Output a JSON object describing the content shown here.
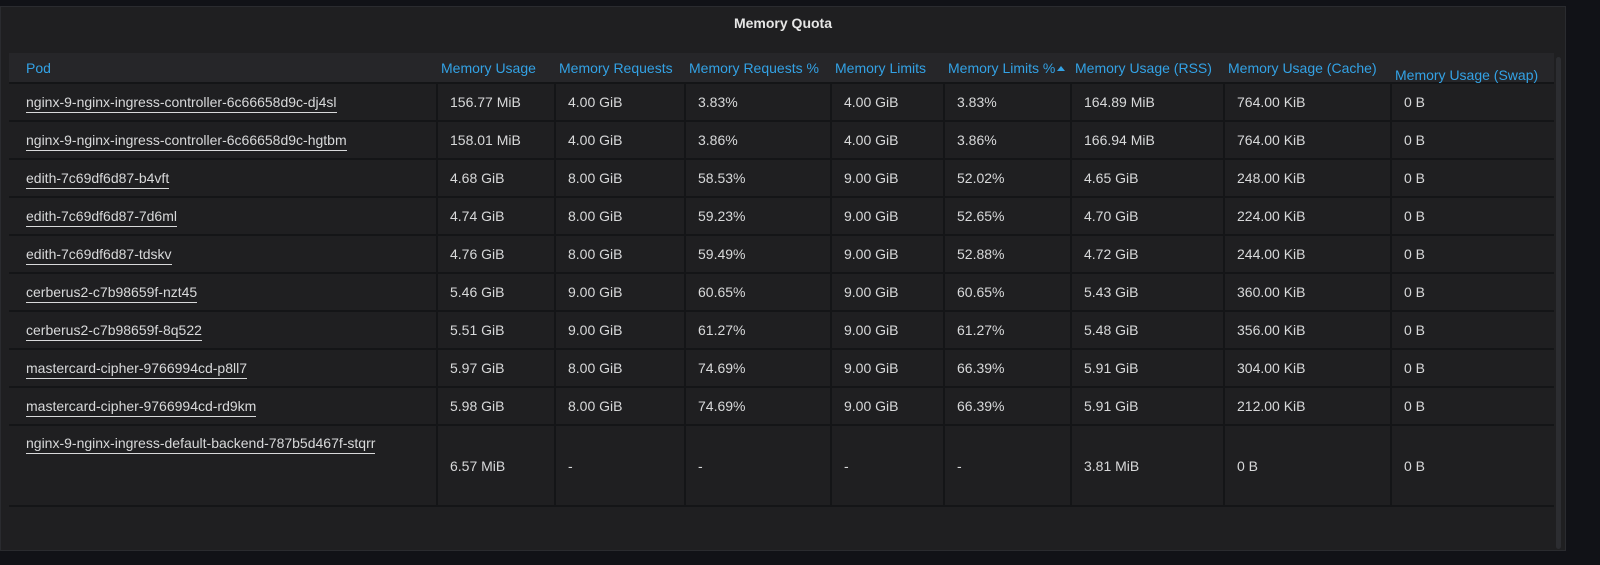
{
  "panel": {
    "title": "Memory Quota"
  },
  "table": {
    "columns": [
      "Pod",
      "Memory Usage",
      "Memory Requests",
      "Memory Requests %",
      "Memory Limits",
      "Memory Limits %",
      "Memory Usage (RSS)",
      "Memory Usage (Cache)",
      "Memory Usage (Swap)"
    ],
    "sorted_column": "Memory Limits %",
    "sort_direction": "ascending",
    "rows": [
      [
        "nginx-9-nginx-ingress-controller-6c66658d9c-dj4sl",
        "156.77 MiB",
        "4.00 GiB",
        "3.83%",
        "4.00 GiB",
        "3.83%",
        "164.89 MiB",
        "764.00 KiB",
        "0 B"
      ],
      [
        "nginx-9-nginx-ingress-controller-6c66658d9c-hgtbm",
        "158.01 MiB",
        "4.00 GiB",
        "3.86%",
        "4.00 GiB",
        "3.86%",
        "166.94 MiB",
        "764.00 KiB",
        "0 B"
      ],
      [
        "edith-7c69df6d87-b4vft",
        "4.68 GiB",
        "8.00 GiB",
        "58.53%",
        "9.00 GiB",
        "52.02%",
        "4.65 GiB",
        "248.00 KiB",
        "0 B"
      ],
      [
        "edith-7c69df6d87-7d6ml",
        "4.74 GiB",
        "8.00 GiB",
        "59.23%",
        "9.00 GiB",
        "52.65%",
        "4.70 GiB",
        "224.00 KiB",
        "0 B"
      ],
      [
        "edith-7c69df6d87-tdskv",
        "4.76 GiB",
        "8.00 GiB",
        "59.49%",
        "9.00 GiB",
        "52.88%",
        "4.72 GiB",
        "244.00 KiB",
        "0 B"
      ],
      [
        "cerberus2-c7b98659f-nzt45",
        "5.46 GiB",
        "9.00 GiB",
        "60.65%",
        "9.00 GiB",
        "60.65%",
        "5.43 GiB",
        "360.00 KiB",
        "0 B"
      ],
      [
        "cerberus2-c7b98659f-8q522",
        "5.51 GiB",
        "9.00 GiB",
        "61.27%",
        "9.00 GiB",
        "61.27%",
        "5.48 GiB",
        "356.00 KiB",
        "0 B"
      ],
      [
        "mastercard-cipher-9766994cd-p8ll7",
        "5.97 GiB",
        "8.00 GiB",
        "74.69%",
        "9.00 GiB",
        "66.39%",
        "5.91 GiB",
        "304.00 KiB",
        "0 B"
      ],
      [
        "mastercard-cipher-9766994cd-rd9km",
        "5.98 GiB",
        "8.00 GiB",
        "74.69%",
        "9.00 GiB",
        "66.39%",
        "5.91 GiB",
        "212.00 KiB",
        "0 B"
      ],
      [
        "nginx-9-nginx-ingress-default-backend-787b5d467f-stqrr",
        "6.57 MiB",
        "-",
        "-",
        "-",
        "-",
        "3.81 MiB",
        "0 B",
        "0 B"
      ]
    ]
  },
  "colors": {
    "header_text": "#33a2e5",
    "panel_bg": "#1f1f21",
    "page_bg": "#111217",
    "cell_text": "#d8d9da"
  }
}
